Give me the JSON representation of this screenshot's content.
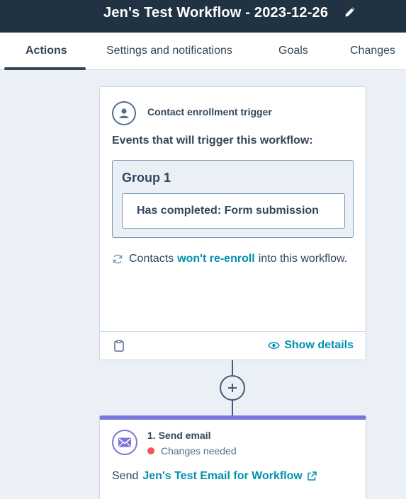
{
  "header": {
    "title": "Jen's Test Workflow - 2023-12-26",
    "edit_icon": "pencil-icon"
  },
  "tabs": [
    {
      "label": "Actions",
      "active": true
    },
    {
      "label": "Settings and notifications",
      "active": false
    },
    {
      "label": "Goals",
      "active": false
    },
    {
      "label": "Changes",
      "active": false
    }
  ],
  "trigger": {
    "icon": "contact-person-icon",
    "type_label": "Contact enrollment trigger",
    "events_label": "Events that will trigger this workflow:",
    "group_title": "Group 1",
    "filter_label": "Has completed: Form submission",
    "reenroll_prefix": "Contacts",
    "reenroll_link": "won't re-enroll",
    "reenroll_suffix": "into this workflow.",
    "show_details_label": "Show details"
  },
  "action": {
    "icon": "envelope-icon",
    "title": "1. Send email",
    "status": "Changes needed",
    "status_color": "#f2545b",
    "send_prefix": "Send",
    "email_link": "Jen's Test Email for Workflow"
  },
  "colors": {
    "header_bg": "#213343",
    "link": "#0091ae",
    "action_accent": "#7b76d9",
    "canvas_bg": "#eaf0f6"
  }
}
